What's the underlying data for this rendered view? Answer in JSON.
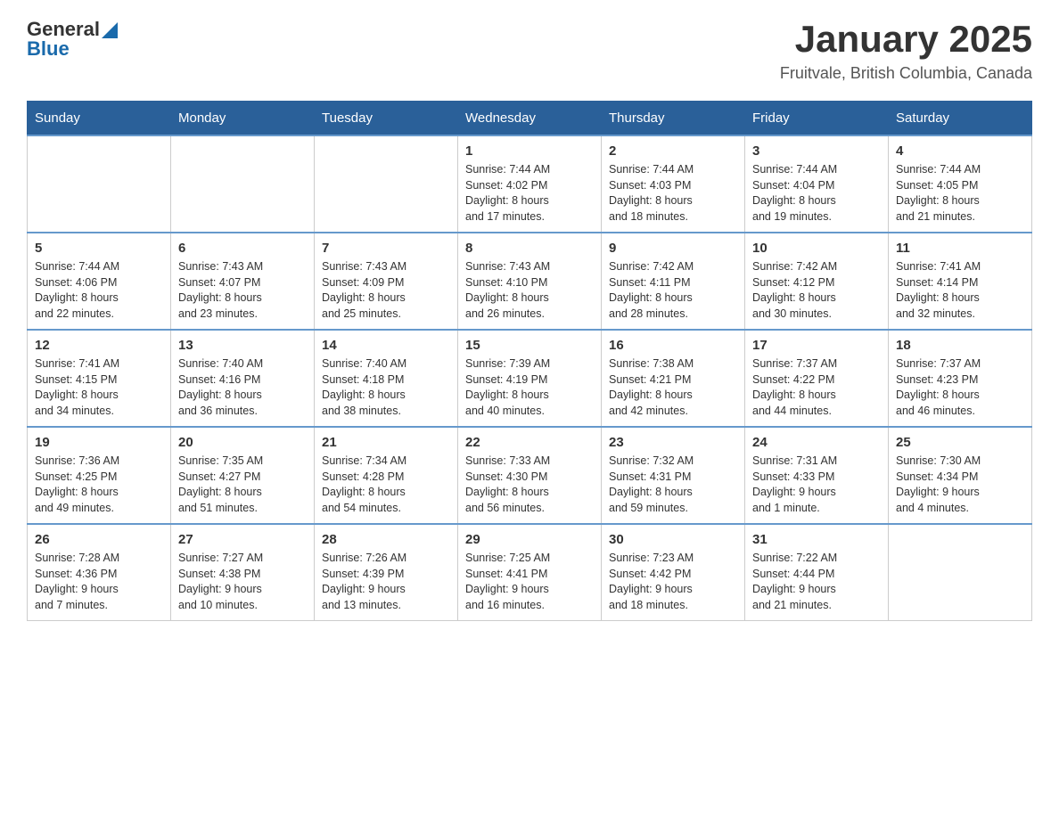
{
  "header": {
    "logo": {
      "general": "General",
      "blue": "Blue"
    },
    "title": "January 2025",
    "location": "Fruitvale, British Columbia, Canada"
  },
  "days_of_week": [
    "Sunday",
    "Monday",
    "Tuesday",
    "Wednesday",
    "Thursday",
    "Friday",
    "Saturday"
  ],
  "weeks": [
    [
      {
        "day": "",
        "info": ""
      },
      {
        "day": "",
        "info": ""
      },
      {
        "day": "",
        "info": ""
      },
      {
        "day": "1",
        "info": "Sunrise: 7:44 AM\nSunset: 4:02 PM\nDaylight: 8 hours\nand 17 minutes."
      },
      {
        "day": "2",
        "info": "Sunrise: 7:44 AM\nSunset: 4:03 PM\nDaylight: 8 hours\nand 18 minutes."
      },
      {
        "day": "3",
        "info": "Sunrise: 7:44 AM\nSunset: 4:04 PM\nDaylight: 8 hours\nand 19 minutes."
      },
      {
        "day": "4",
        "info": "Sunrise: 7:44 AM\nSunset: 4:05 PM\nDaylight: 8 hours\nand 21 minutes."
      }
    ],
    [
      {
        "day": "5",
        "info": "Sunrise: 7:44 AM\nSunset: 4:06 PM\nDaylight: 8 hours\nand 22 minutes."
      },
      {
        "day": "6",
        "info": "Sunrise: 7:43 AM\nSunset: 4:07 PM\nDaylight: 8 hours\nand 23 minutes."
      },
      {
        "day": "7",
        "info": "Sunrise: 7:43 AM\nSunset: 4:09 PM\nDaylight: 8 hours\nand 25 minutes."
      },
      {
        "day": "8",
        "info": "Sunrise: 7:43 AM\nSunset: 4:10 PM\nDaylight: 8 hours\nand 26 minutes."
      },
      {
        "day": "9",
        "info": "Sunrise: 7:42 AM\nSunset: 4:11 PM\nDaylight: 8 hours\nand 28 minutes."
      },
      {
        "day": "10",
        "info": "Sunrise: 7:42 AM\nSunset: 4:12 PM\nDaylight: 8 hours\nand 30 minutes."
      },
      {
        "day": "11",
        "info": "Sunrise: 7:41 AM\nSunset: 4:14 PM\nDaylight: 8 hours\nand 32 minutes."
      }
    ],
    [
      {
        "day": "12",
        "info": "Sunrise: 7:41 AM\nSunset: 4:15 PM\nDaylight: 8 hours\nand 34 minutes."
      },
      {
        "day": "13",
        "info": "Sunrise: 7:40 AM\nSunset: 4:16 PM\nDaylight: 8 hours\nand 36 minutes."
      },
      {
        "day": "14",
        "info": "Sunrise: 7:40 AM\nSunset: 4:18 PM\nDaylight: 8 hours\nand 38 minutes."
      },
      {
        "day": "15",
        "info": "Sunrise: 7:39 AM\nSunset: 4:19 PM\nDaylight: 8 hours\nand 40 minutes."
      },
      {
        "day": "16",
        "info": "Sunrise: 7:38 AM\nSunset: 4:21 PM\nDaylight: 8 hours\nand 42 minutes."
      },
      {
        "day": "17",
        "info": "Sunrise: 7:37 AM\nSunset: 4:22 PM\nDaylight: 8 hours\nand 44 minutes."
      },
      {
        "day": "18",
        "info": "Sunrise: 7:37 AM\nSunset: 4:23 PM\nDaylight: 8 hours\nand 46 minutes."
      }
    ],
    [
      {
        "day": "19",
        "info": "Sunrise: 7:36 AM\nSunset: 4:25 PM\nDaylight: 8 hours\nand 49 minutes."
      },
      {
        "day": "20",
        "info": "Sunrise: 7:35 AM\nSunset: 4:27 PM\nDaylight: 8 hours\nand 51 minutes."
      },
      {
        "day": "21",
        "info": "Sunrise: 7:34 AM\nSunset: 4:28 PM\nDaylight: 8 hours\nand 54 minutes."
      },
      {
        "day": "22",
        "info": "Sunrise: 7:33 AM\nSunset: 4:30 PM\nDaylight: 8 hours\nand 56 minutes."
      },
      {
        "day": "23",
        "info": "Sunrise: 7:32 AM\nSunset: 4:31 PM\nDaylight: 8 hours\nand 59 minutes."
      },
      {
        "day": "24",
        "info": "Sunrise: 7:31 AM\nSunset: 4:33 PM\nDaylight: 9 hours\nand 1 minute."
      },
      {
        "day": "25",
        "info": "Sunrise: 7:30 AM\nSunset: 4:34 PM\nDaylight: 9 hours\nand 4 minutes."
      }
    ],
    [
      {
        "day": "26",
        "info": "Sunrise: 7:28 AM\nSunset: 4:36 PM\nDaylight: 9 hours\nand 7 minutes."
      },
      {
        "day": "27",
        "info": "Sunrise: 7:27 AM\nSunset: 4:38 PM\nDaylight: 9 hours\nand 10 minutes."
      },
      {
        "day": "28",
        "info": "Sunrise: 7:26 AM\nSunset: 4:39 PM\nDaylight: 9 hours\nand 13 minutes."
      },
      {
        "day": "29",
        "info": "Sunrise: 7:25 AM\nSunset: 4:41 PM\nDaylight: 9 hours\nand 16 minutes."
      },
      {
        "day": "30",
        "info": "Sunrise: 7:23 AM\nSunset: 4:42 PM\nDaylight: 9 hours\nand 18 minutes."
      },
      {
        "day": "31",
        "info": "Sunrise: 7:22 AM\nSunset: 4:44 PM\nDaylight: 9 hours\nand 21 minutes."
      },
      {
        "day": "",
        "info": ""
      }
    ]
  ]
}
